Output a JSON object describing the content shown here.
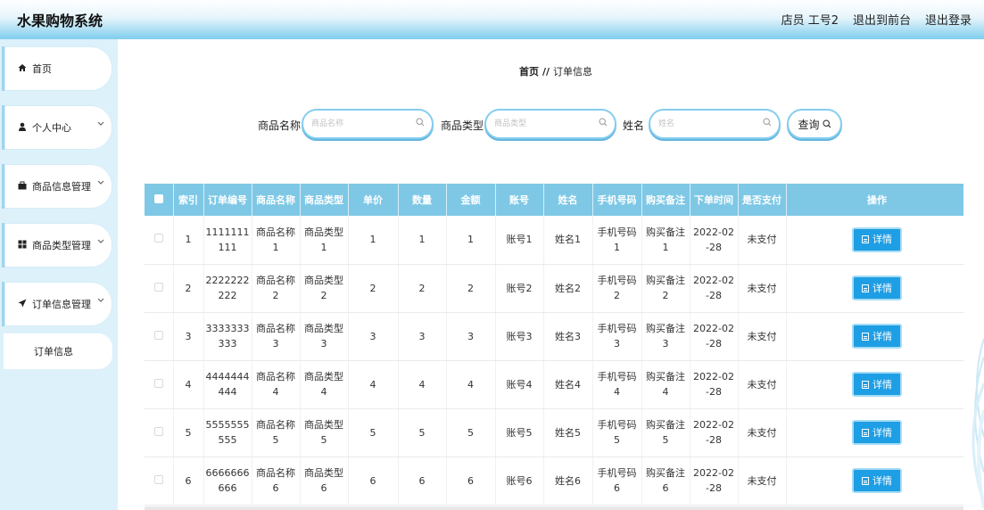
{
  "header": {
    "app_title": "水果购物系统",
    "user_label": "店员 工号2",
    "back_to_front": "退出到前台",
    "logout": "退出登录"
  },
  "sidebar": {
    "items": [
      {
        "label": "首页",
        "icon": "home-icon"
      },
      {
        "label": "个人中心",
        "icon": "user-icon"
      },
      {
        "label": "商品信息管理",
        "icon": "bag-icon"
      },
      {
        "label": "商品类型管理",
        "icon": "grid-icon"
      },
      {
        "label": "订单信息管理",
        "icon": "send-icon"
      }
    ],
    "sub_item": "订单信息"
  },
  "breadcrumb": {
    "home": "首页",
    "separator": "//",
    "current": "订单信息"
  },
  "search": {
    "fields": [
      {
        "label": "商品名称",
        "placeholder": "商品名称"
      },
      {
        "label": "商品类型",
        "placeholder": "商品类型"
      },
      {
        "label": "姓名",
        "placeholder": "姓名"
      }
    ],
    "button_label": "查询"
  },
  "table": {
    "columns": [
      "",
      "索引",
      "订单编号",
      "商品名称",
      "商品类型",
      "单价",
      "数量",
      "金额",
      "账号",
      "姓名",
      "手机号码",
      "购买备注",
      "下单时间",
      "是否支付",
      "操作"
    ],
    "detail_label": "详情",
    "rows": [
      {
        "index": "1",
        "order_no_1": "1111111",
        "order_no_2": "111",
        "name_1": "商品名称",
        "name_2": "1",
        "type_1": "商品类型",
        "type_2": "1",
        "price": "1",
        "qty": "1",
        "amount": "1",
        "account": "账号1",
        "person": "姓名1",
        "phone_1": "手机号码",
        "phone_2": "1",
        "note_1": "购买备注",
        "note_2": "1",
        "date_1": "2022-02",
        "date_2": "-28",
        "paid": "未支付"
      },
      {
        "index": "2",
        "order_no_1": "2222222",
        "order_no_2": "222",
        "name_1": "商品名称",
        "name_2": "2",
        "type_1": "商品类型",
        "type_2": "2",
        "price": "2",
        "qty": "2",
        "amount": "2",
        "account": "账号2",
        "person": "姓名2",
        "phone_1": "手机号码",
        "phone_2": "2",
        "note_1": "购买备注",
        "note_2": "2",
        "date_1": "2022-02",
        "date_2": "-28",
        "paid": "未支付"
      },
      {
        "index": "3",
        "order_no_1": "3333333",
        "order_no_2": "333",
        "name_1": "商品名称",
        "name_2": "3",
        "type_1": "商品类型",
        "type_2": "3",
        "price": "3",
        "qty": "3",
        "amount": "3",
        "account": "账号3",
        "person": "姓名3",
        "phone_1": "手机号码",
        "phone_2": "3",
        "note_1": "购买备注",
        "note_2": "3",
        "date_1": "2022-02",
        "date_2": "-28",
        "paid": "未支付"
      },
      {
        "index": "4",
        "order_no_1": "4444444",
        "order_no_2": "444",
        "name_1": "商品名称",
        "name_2": "4",
        "type_1": "商品类型",
        "type_2": "4",
        "price": "4",
        "qty": "4",
        "amount": "4",
        "account": "账号4",
        "person": "姓名4",
        "phone_1": "手机号码",
        "phone_2": "4",
        "note_1": "购买备注",
        "note_2": "4",
        "date_1": "2022-02",
        "date_2": "-28",
        "paid": "未支付"
      },
      {
        "index": "5",
        "order_no_1": "5555555",
        "order_no_2": "555",
        "name_1": "商品名称",
        "name_2": "5",
        "type_1": "商品类型",
        "type_2": "5",
        "price": "5",
        "qty": "5",
        "amount": "5",
        "account": "账号5",
        "person": "姓名5",
        "phone_1": "手机号码",
        "phone_2": "5",
        "note_1": "购买备注",
        "note_2": "5",
        "date_1": "2022-02",
        "date_2": "-28",
        "paid": "未支付"
      },
      {
        "index": "6",
        "order_no_1": "6666666",
        "order_no_2": "666",
        "name_1": "商品名称",
        "name_2": "6",
        "type_1": "商品类型",
        "type_2": "6",
        "price": "6",
        "qty": "6",
        "amount": "6",
        "account": "账号6",
        "person": "姓名6",
        "phone_1": "手机号码",
        "phone_2": "6",
        "note_1": "购买备注",
        "note_2": "6",
        "date_1": "2022-02",
        "date_2": "-28",
        "paid": "未支付"
      }
    ]
  },
  "colors": {
    "accent": "#7ec8e6",
    "button": "#1e9ee4",
    "sidebar_bg": "#ddf1fb"
  }
}
